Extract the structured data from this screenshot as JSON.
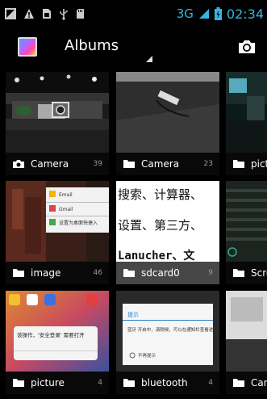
{
  "status_bar": {
    "network": "3G",
    "time": "02:34"
  },
  "action_bar": {
    "title": "Albums"
  },
  "albums": [
    {
      "name": "Camera",
      "count": "39",
      "icon": "camera-icon"
    },
    {
      "name": "Camera",
      "count": "23",
      "icon": "folder-icon"
    },
    {
      "name": "pictu",
      "count": "",
      "icon": "folder-icon"
    },
    {
      "name": "image",
      "count": "46",
      "icon": "folder-icon"
    },
    {
      "name": "sdcard0",
      "count": "9",
      "icon": "folder-icon"
    },
    {
      "name": "Scre",
      "count": "",
      "icon": "folder-icon"
    },
    {
      "name": "picture",
      "count": "4",
      "icon": "folder-icon"
    },
    {
      "name": "bluetooth",
      "count": "4",
      "icon": "folder-icon"
    },
    {
      "name": "Cam",
      "count": "",
      "icon": "folder-icon"
    }
  ],
  "thumb_text": {
    "sdcard0_line1": "搜索、计算器、",
    "sdcard0_line2": "设置、第三方、",
    "sdcard0_line3": "Lanucher、文",
    "image_menu1": "Email",
    "image_menu2": "Gmail",
    "image_menu3": "设置为桌面快捷入",
    "bluetooth_dialog_title": "提示",
    "bluetooth_dialog_body": "蓝牙 开启中，请稍候，可以在通知栏查看进度。",
    "bluetooth_dialog_check": "不再提示",
    "picture_dialog": "该操作，'安全登录' 需要打开"
  },
  "colors": {
    "accent": "#33b5e5",
    "caption_bg": "#000000"
  }
}
